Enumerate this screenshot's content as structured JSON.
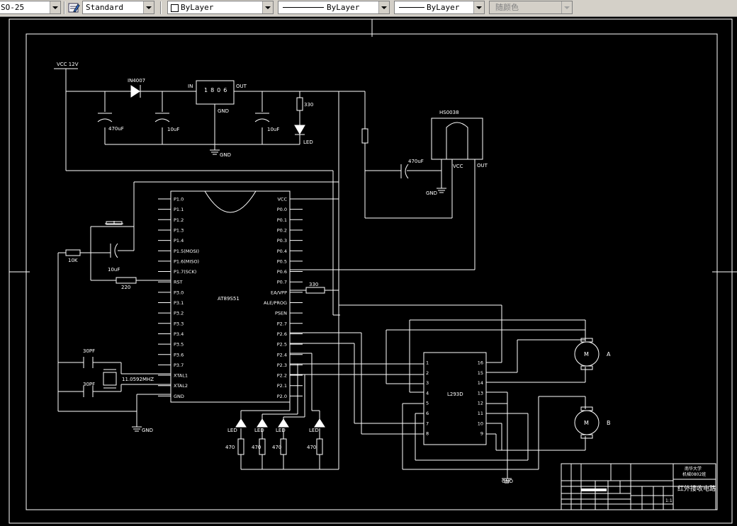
{
  "toolbar": {
    "dimstyle": "SO-25",
    "textstyle": "Standard",
    "layer": "ByLayer",
    "linetype": "ByLayer",
    "lineweight": "ByLayer",
    "plotstyle": "随颜色"
  },
  "schematic": {
    "vcc": "VCC 12V",
    "diode": "IN4007",
    "regulator": "1806",
    "reg_in": "IN",
    "reg_out": "OUT",
    "reg_gnd": "GND",
    "cap1": "470uF",
    "cap2": "10uF",
    "cap3": "10uF",
    "gnd": "GND",
    "r_led": "330",
    "led": "LED",
    "sensor": "HS0038",
    "sensor_vcc": "VCC",
    "sensor_out": "OUT",
    "sensor_cap": "470uF",
    "sensor_gnd": "GND",
    "mcu": "AT89S51",
    "left_pins": [
      "P1.0",
      "P1.1",
      "P1.2",
      "P1.3",
      "P1.4",
      "P1.5(MOSI)",
      "P1.6(MISO)",
      "P1.7(SCK)",
      "RST",
      "P3.0",
      "P3.1",
      "P3.2",
      "P3.3",
      "P3.4",
      "P3.5",
      "P3.6",
      "P3.7",
      "XTAL1",
      "XTAL2",
      "GND"
    ],
    "right_pins": [
      "VCC",
      "P0.0",
      "P0.1",
      "P0.2",
      "P0.3",
      "P0.4",
      "P0.5",
      "P0.6",
      "P0.7",
      "EA/VPP",
      "ALE/PROG",
      "PSEN",
      "P2.7",
      "P2.6",
      "P2.5",
      "P2.4",
      "P2.3",
      "P2.2",
      "P2.1",
      "P2.0"
    ],
    "r_ea": "330",
    "r_pull": "10K",
    "cap_rst": "10uF",
    "r_rst": "220",
    "crystal_cap1": "30PF",
    "crystal_cap2": "30PF",
    "crystal": "11.0592MHZ",
    "gnd2": "GND",
    "leds": [
      "LED",
      "LED",
      "LED",
      "LED"
    ],
    "led_res": [
      "470",
      "470",
      "470",
      "470"
    ],
    "driver": "L293D",
    "driver_left": [
      "1",
      "2",
      "3",
      "4",
      "5",
      "6",
      "7",
      "8"
    ],
    "driver_right": [
      "16",
      "15",
      "14",
      "13",
      "12",
      "11",
      "10",
      "9"
    ],
    "driver_gnd": "GND",
    "motor_label": "M",
    "motor_a": "A",
    "motor_b": "B",
    "title_block": {
      "school": "南华大学",
      "major": "机械0802班",
      "title": "红外接收电路",
      "scale": "1:1"
    }
  }
}
